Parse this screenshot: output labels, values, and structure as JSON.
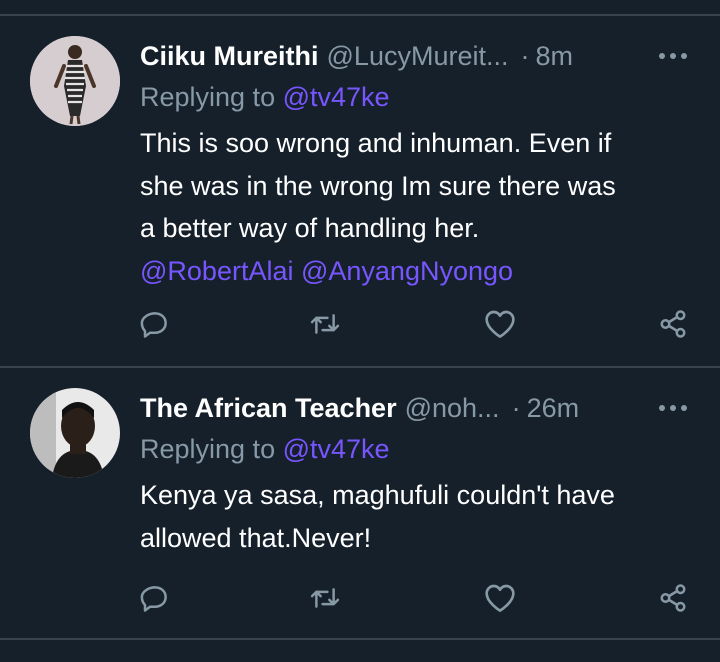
{
  "tweets": [
    {
      "name": "Ciiku Mureithi",
      "handle": "@LucyMureit...",
      "separator": "·",
      "time": "8m",
      "replying_prefix": "Replying to ",
      "replying_to": "@tv47ke",
      "body_lines": [
        "This is soo wrong and inhuman. Even if",
        "she was in the wrong Im sure there was",
        "a better way of handling her."
      ],
      "mentions": "@RobertAlai @AnyangNyongo"
    },
    {
      "name": "The African Teacher",
      "handle": "@noh...",
      "separator": "·",
      "time": "26m",
      "replying_prefix": "Replying to ",
      "replying_to": "@tv47ke",
      "body_lines": [
        "Kenya ya sasa, maghufuli couldn't have",
        "allowed that.Never!"
      ]
    }
  ],
  "icons": {
    "more": "more-dots-icon",
    "reply": "reply-bubble-icon",
    "retweet": "retweet-icon",
    "like": "heart-icon",
    "share": "share-icon"
  },
  "colors": {
    "background": "#15202b",
    "divider": "#38444d",
    "text_primary": "#ffffff",
    "text_secondary": "#8899a6",
    "link": "#7856ff"
  }
}
